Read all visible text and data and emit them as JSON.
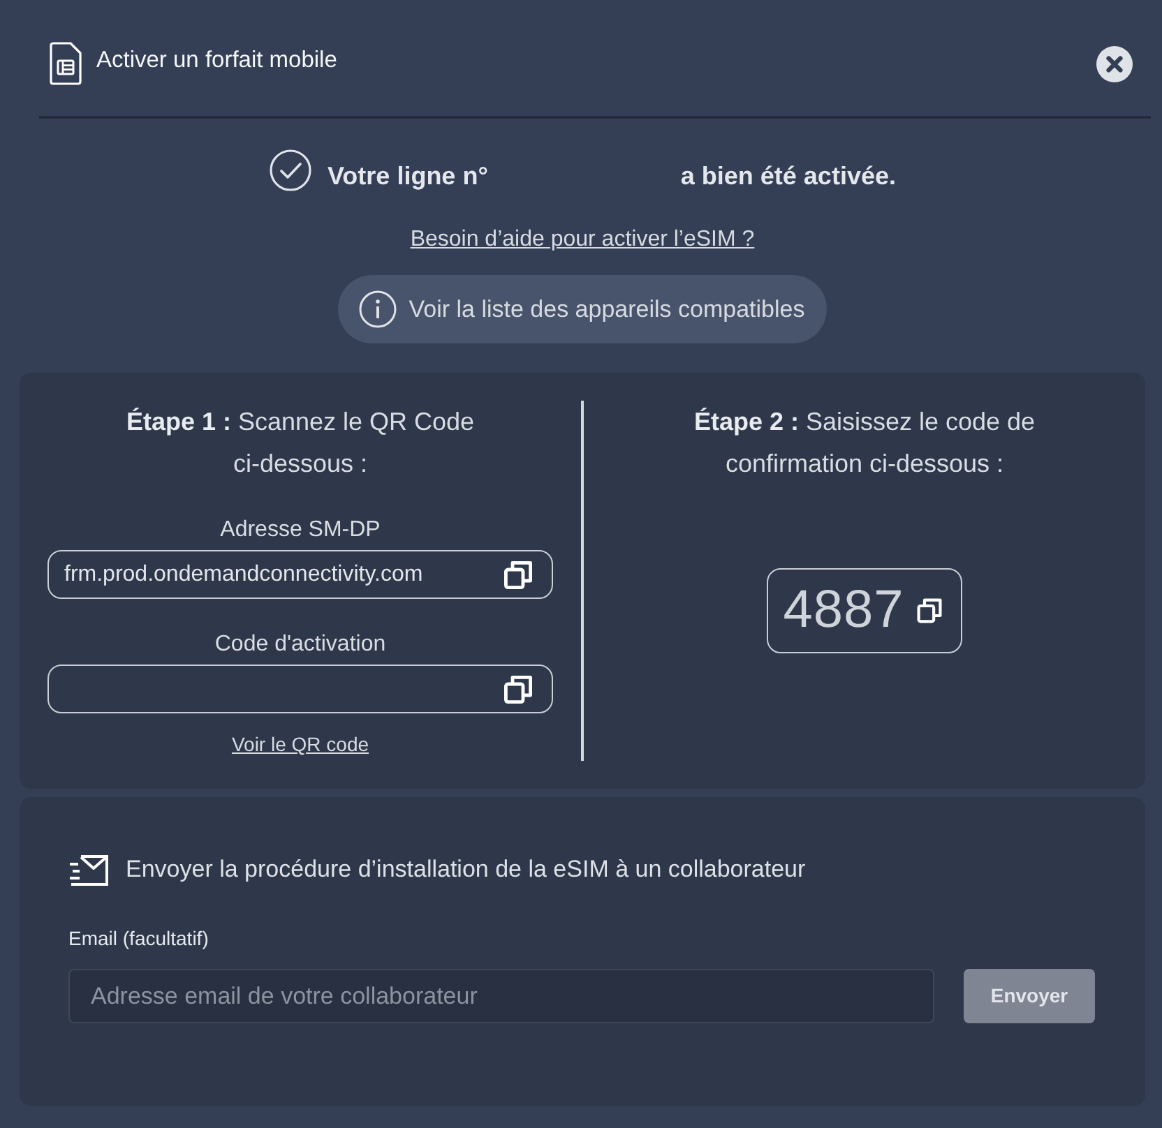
{
  "header": {
    "title": "Activer un forfait mobile"
  },
  "success": {
    "prefix": "Votre ligne n°",
    "suffix": "a bien été activée."
  },
  "help_link": "Besoin d’aide pour activer l’eSIM ?",
  "devices_button": "Voir la liste des appareils compatibles",
  "steps": [
    {
      "kind": "scan",
      "heading": "**Étape 1 :** Scannez le QR Code ci-dessous :",
      "fields": [
        {
          "label": "Adresse SM-DP",
          "value": "frm.prod.ondemandconnectivity.com"
        },
        {
          "label": "Code d'activation"
        }
      ],
      "link": "Voir le QR code"
    },
    {
      "kind": "code",
      "heading": "**Étape 2 :** Saisissez le code de confirmation ci-dessous :",
      "code": "4887"
    }
  ],
  "send": {
    "title": "Envoyer la procédure d’installation de la eSIM à un collaborateur",
    "email": {
      "label": "Email (facultatif)",
      "placeholder": "Adresse email de votre collaborateur"
    },
    "button": {
      "label": "Envoyer",
      "disabled": true
    }
  }
}
